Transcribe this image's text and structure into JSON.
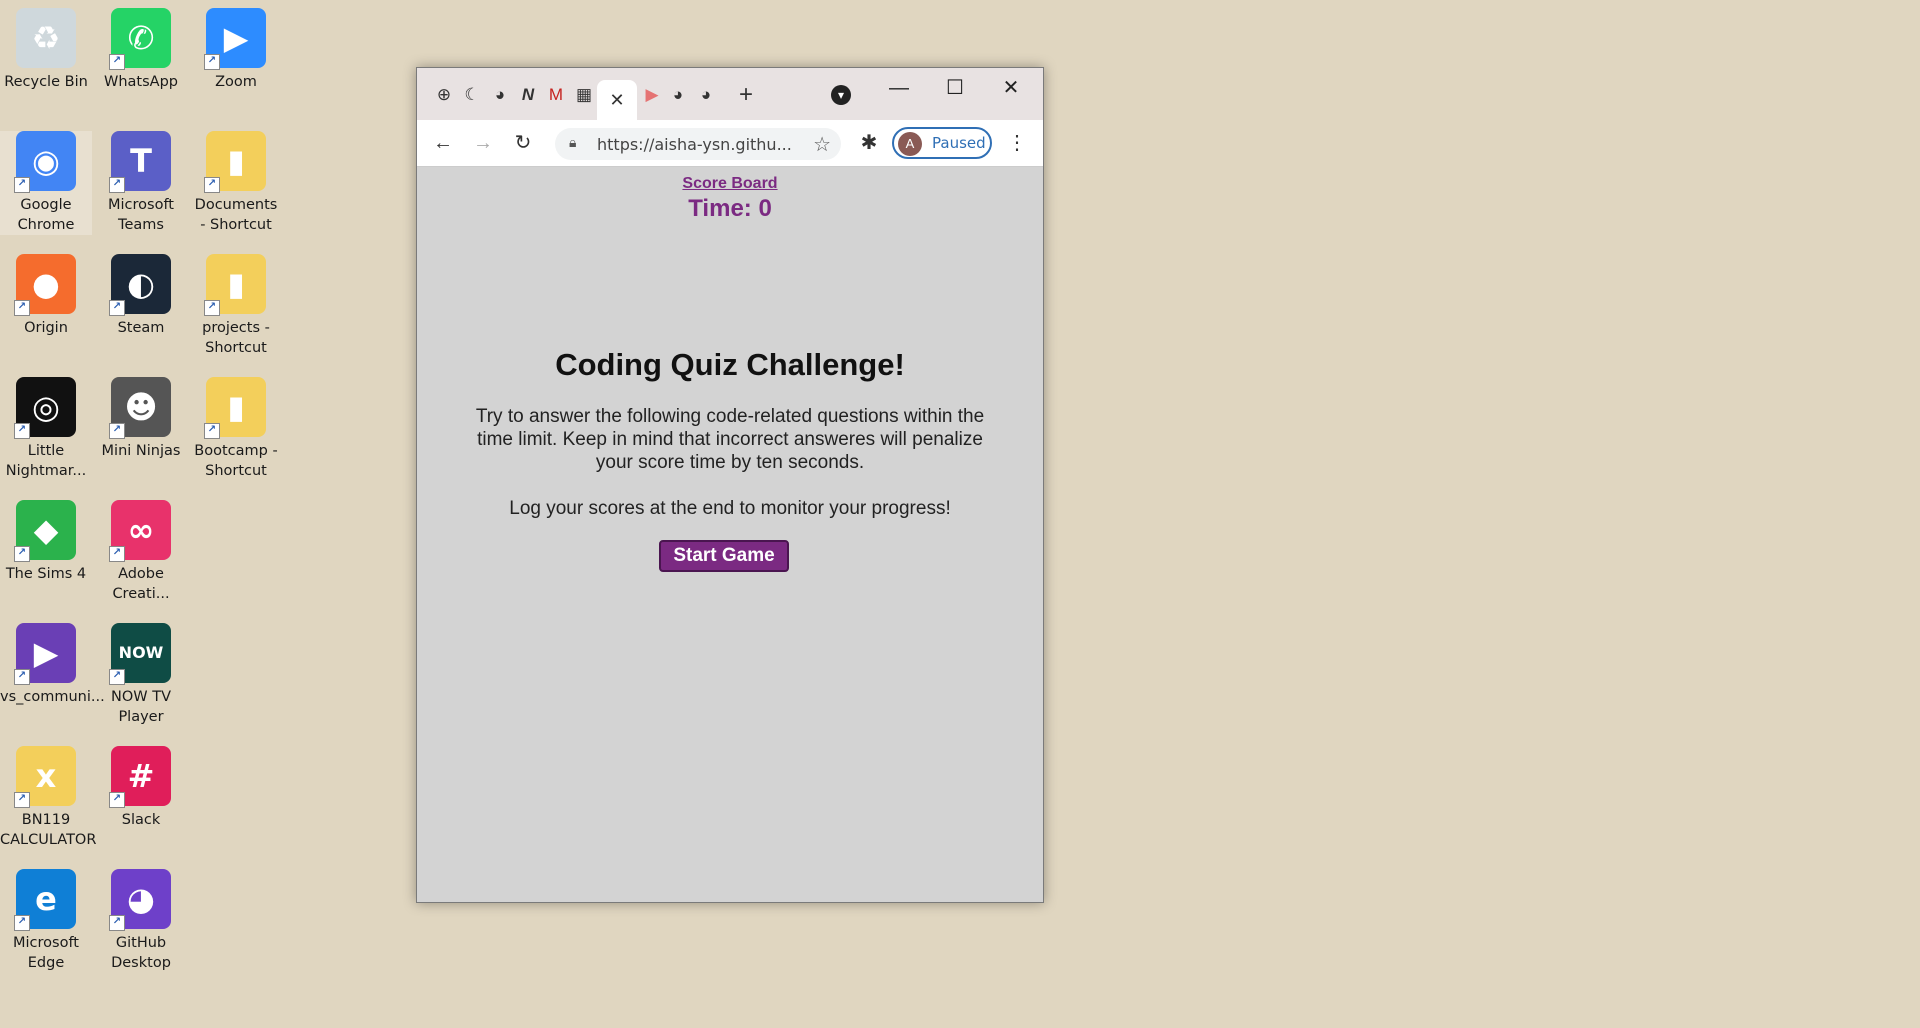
{
  "desktop": {
    "icons": [
      {
        "label": "Recycle Bin",
        "glyph": "♻",
        "color": "#cfd8dc"
      },
      {
        "label": "WhatsApp",
        "glyph": "✆",
        "color": "#25d366"
      },
      {
        "label": "Zoom",
        "glyph": "▶",
        "color": "#2d8cff"
      },
      {
        "label": "Google Chrome",
        "glyph": "◉",
        "color": "#4285f4"
      },
      {
        "label": "Microsoft Teams",
        "glyph": "T",
        "color": "#5b5fc7"
      },
      {
        "label": "Documents - Shortcut",
        "glyph": "▮",
        "color": "#f3cf5b"
      },
      {
        "label": "Origin",
        "glyph": "●",
        "color": "#f56c2d"
      },
      {
        "label": "Steam",
        "glyph": "◐",
        "color": "#1b2838"
      },
      {
        "label": "projects - Shortcut",
        "glyph": "▮",
        "color": "#f3cf5b"
      },
      {
        "label": "Little Nightmar...",
        "glyph": "◎",
        "color": "#111111"
      },
      {
        "label": "Mini Ninjas",
        "glyph": "☻",
        "color": "#555555"
      },
      {
        "label": "Bootcamp - Shortcut",
        "glyph": "▮",
        "color": "#f3cf5b"
      },
      {
        "label": "The Sims 4",
        "glyph": "◆",
        "color": "#2bb24c"
      },
      {
        "label": "Adobe Creati...",
        "glyph": "∞",
        "color": "#e8326b"
      },
      {
        "label": "vs_communi...",
        "glyph": "▶",
        "color": "#6a3fb5"
      },
      {
        "label": "NOW TV Player",
        "glyph": "NOW",
        "color": "#0f4c45"
      },
      {
        "label": "BN119 CALCULATOR",
        "glyph": "x",
        "color": "#f3cf5b"
      },
      {
        "label": "Slack",
        "glyph": "#",
        "color": "#e01e5a"
      },
      {
        "label": "Microsoft Edge",
        "glyph": "e",
        "color": "#0f7fd6"
      },
      {
        "label": "GitHub Desktop",
        "glyph": "◕",
        "color": "#6e40c9"
      }
    ]
  },
  "browser": {
    "tabs": [
      "⊕",
      "☾",
      "◕",
      "N",
      "M",
      "▦",
      "✕",
      "▶",
      "◕",
      "◕"
    ],
    "new_tab": "+",
    "tab_search": "▾",
    "minimize": "—",
    "maximize": "☐",
    "close": "✕",
    "back": "←",
    "forward": "→",
    "reload": "↻",
    "url": "https://aisha-ysn.githu...",
    "star": "☆",
    "extensions": "✱",
    "profile_initial": "A",
    "profile_status": "Paused",
    "menu": "⋮"
  },
  "page": {
    "scoreboard": "Score Board",
    "timer": "Time: 0",
    "title": "Coding Quiz Challenge!",
    "description": "Try to answer the following code-related questions within the time limit. Keep in mind that incorrect answeres will penalize your score time by ten seconds.",
    "log_text": "Log your scores at the end to monitor your progress!",
    "start_button": "Start Game"
  }
}
